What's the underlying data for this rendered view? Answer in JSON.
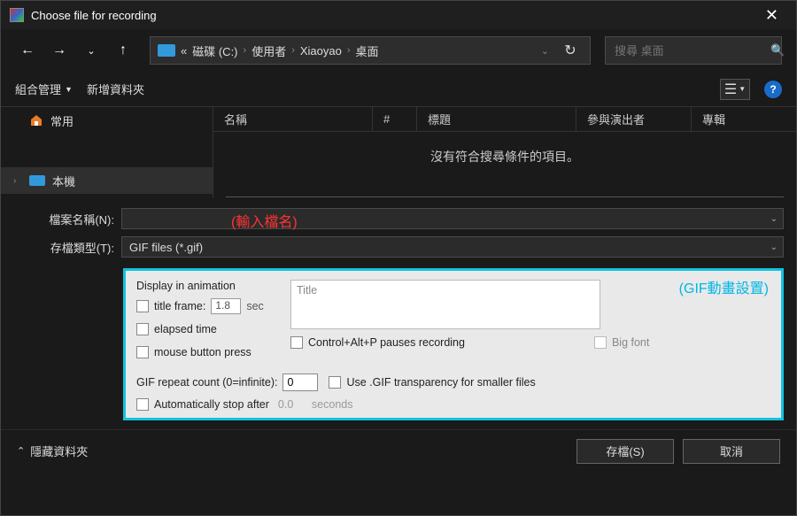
{
  "titlebar": {
    "title": "Choose file for recording"
  },
  "nav": {
    "crumbs_prefix": "«",
    "crumbs": [
      "磁碟 (C:)",
      "使用者",
      "Xiaoyao",
      "桌面"
    ]
  },
  "search": {
    "placeholder": "搜尋 桌面"
  },
  "toolbar": {
    "organize": "組合管理",
    "newfolder": "新增資料夾"
  },
  "sidebar": {
    "items": [
      {
        "label": "常用"
      },
      {
        "label": "本機"
      }
    ]
  },
  "list": {
    "columns": [
      "名稱",
      "#",
      "標題",
      "參與演出者",
      "專輯"
    ],
    "empty": "沒有符合搜尋條件的項目。"
  },
  "fields": {
    "filename_label": "檔案名稱(N):",
    "filename_value": "",
    "filetype_label": "存檔類型(T):",
    "filetype_value": "GIF files (*.gif)"
  },
  "annotations": {
    "input_hint": "(輸入檔名)",
    "panel_hint": "(GIF動畫設置)"
  },
  "options": {
    "display_group": "Display in animation",
    "title_frame": "title frame:",
    "title_frame_value": "1.8",
    "sec": "sec",
    "elapsed_time": "elapsed time",
    "mouse_press": "mouse button press",
    "title_placeholder": "Title",
    "ctrl_alt_p": "Control+Alt+P pauses recording",
    "big_font": "Big font",
    "repeat_label": "GIF repeat count (0=infinite):",
    "repeat_value": "0",
    "use_transparency": "Use .GIF transparency for smaller files",
    "auto_stop": "Automatically stop after",
    "auto_stop_value": "0.0",
    "seconds": "seconds"
  },
  "footer": {
    "hide_folders": "隱藏資料夾",
    "save": "存檔(S)",
    "cancel": "取消"
  }
}
